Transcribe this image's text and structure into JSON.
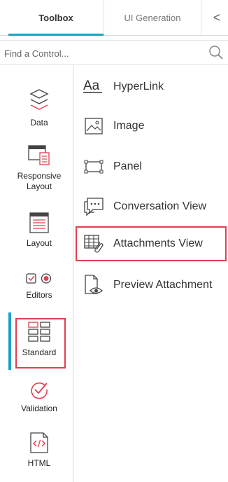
{
  "tabs": {
    "toolbox": "Toolbox",
    "ui_generation": "UI Generation",
    "collapse": "<"
  },
  "search": {
    "placeholder": "Find a Control..."
  },
  "categories": [
    {
      "label": "Data",
      "icon": "layers-icon"
    },
    {
      "label": "Responsive Layout",
      "icon": "responsive-layout-icon"
    },
    {
      "label": "Layout",
      "icon": "layout-icon"
    },
    {
      "label": "Editors",
      "icon": "editors-icon"
    },
    {
      "label": "Standard",
      "icon": "standard-icon",
      "selected": true
    },
    {
      "label": "Validation",
      "icon": "validation-icon"
    },
    {
      "label": "HTML",
      "icon": "html-icon"
    }
  ],
  "controls": [
    {
      "label": "HyperLink",
      "icon": "hyperlink-icon"
    },
    {
      "label": "Image",
      "icon": "image-icon"
    },
    {
      "label": "Panel",
      "icon": "panel-icon"
    },
    {
      "label": "Conversation View",
      "icon": "conversation-icon"
    },
    {
      "label": "Attachments View",
      "icon": "attachments-icon",
      "highlighted": true
    },
    {
      "label": "Preview Attachment",
      "icon": "preview-attachment-icon"
    }
  ],
  "colors": {
    "accent": "#1ba1c4",
    "highlight": "#e0404e",
    "icon_red": "#e0404e",
    "icon_dark": "#444444"
  }
}
